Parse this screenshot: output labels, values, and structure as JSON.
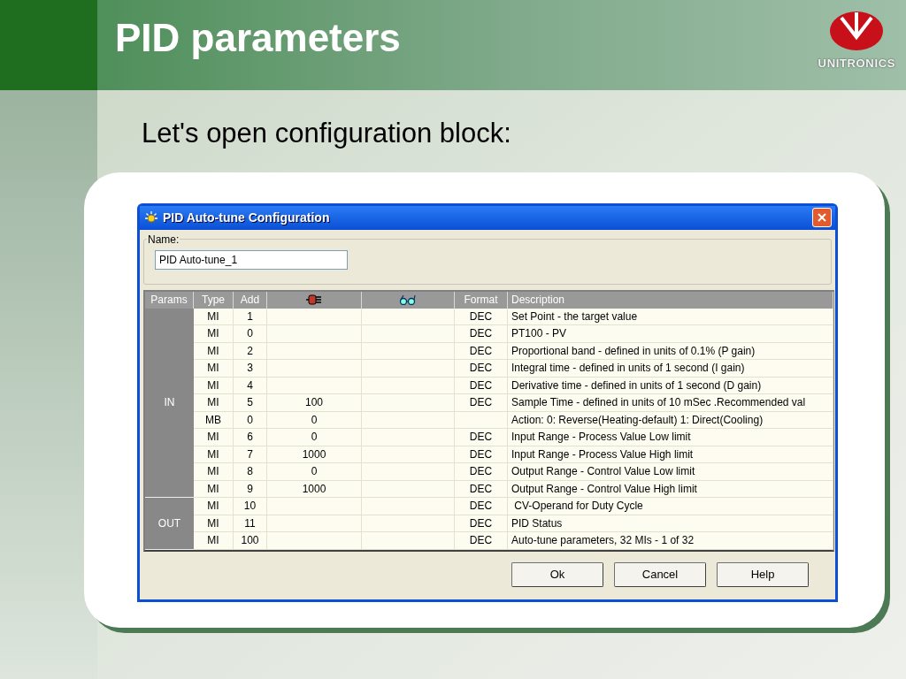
{
  "slide": {
    "title": "PID parameters",
    "logo_text": "UNITRONICS",
    "subtitle": "Let's open configuration block:"
  },
  "dialog": {
    "title": "PID Auto-tune Configuration",
    "name_label": "Name:",
    "name_value": "PID Auto-tune_1",
    "columns": [
      {
        "kind": "text",
        "label": "Params"
      },
      {
        "kind": "text",
        "label": "Type"
      },
      {
        "kind": "text",
        "label": "Add"
      },
      {
        "kind": "plug"
      },
      {
        "kind": "glasses"
      },
      {
        "kind": "text",
        "label": "Format"
      },
      {
        "kind": "text",
        "label": "Description"
      }
    ],
    "groups": [
      {
        "label": "IN",
        "rows": [
          {
            "type": "MI",
            "add": "1",
            "format": "DEC",
            "description": "Set Point - the target value"
          },
          {
            "type": "MI",
            "add": "0",
            "format": "DEC",
            "description": "PT100 - PV"
          },
          {
            "type": "MI",
            "add": "2",
            "format": "DEC",
            "description": "Proportional band - defined in units of 0.1% (P gain)"
          },
          {
            "type": "MI",
            "add": "3",
            "format": "DEC",
            "description": "Integral time - defined in units of 1 second (I gain)"
          },
          {
            "type": "MI",
            "add": "4",
            "format": "DEC",
            "description": "Derivative time - defined in units of 1 second (D gain)"
          },
          {
            "type": "MI",
            "add": "5",
            "column_4": "100",
            "format": "DEC",
            "description": "Sample Time - defined in units of 10 mSec .Recommended val"
          },
          {
            "type": "MB",
            "add": "0",
            "column_4": "0",
            "description": "Action: 0: Reverse(Heating-default) 1: Direct(Cooling)"
          },
          {
            "type": "MI",
            "add": "6",
            "column_4": "0",
            "format": "DEC",
            "description": "Input Range - Process Value Low limit"
          },
          {
            "type": "MI",
            "add": "7",
            "column_4": "1000",
            "format": "DEC",
            "description": "Input Range - Process Value High limit"
          },
          {
            "type": "MI",
            "add": "8",
            "column_4": "0",
            "format": "DEC",
            "description": "Output Range - Control Value Low limit"
          },
          {
            "type": "MI",
            "add": "9",
            "column_4": "1000",
            "format": "DEC",
            "description": "Output Range - Control Value High limit"
          }
        ]
      },
      {
        "label": "OUT",
        "rows": [
          {
            "type": "MI",
            "add": "10",
            "format": "DEC",
            "description": " CV-Operand for Duty Cycle"
          },
          {
            "type": "MI",
            "add": "11",
            "format": "DEC",
            "description": "PID Status"
          },
          {
            "type": "MI",
            "add": "100",
            "format": "DEC",
            "description": "Auto-tune parameters, 32 MIs - 1 of 32"
          }
        ]
      }
    ],
    "buttons": [
      "Ok",
      "Cancel",
      "Help"
    ]
  }
}
